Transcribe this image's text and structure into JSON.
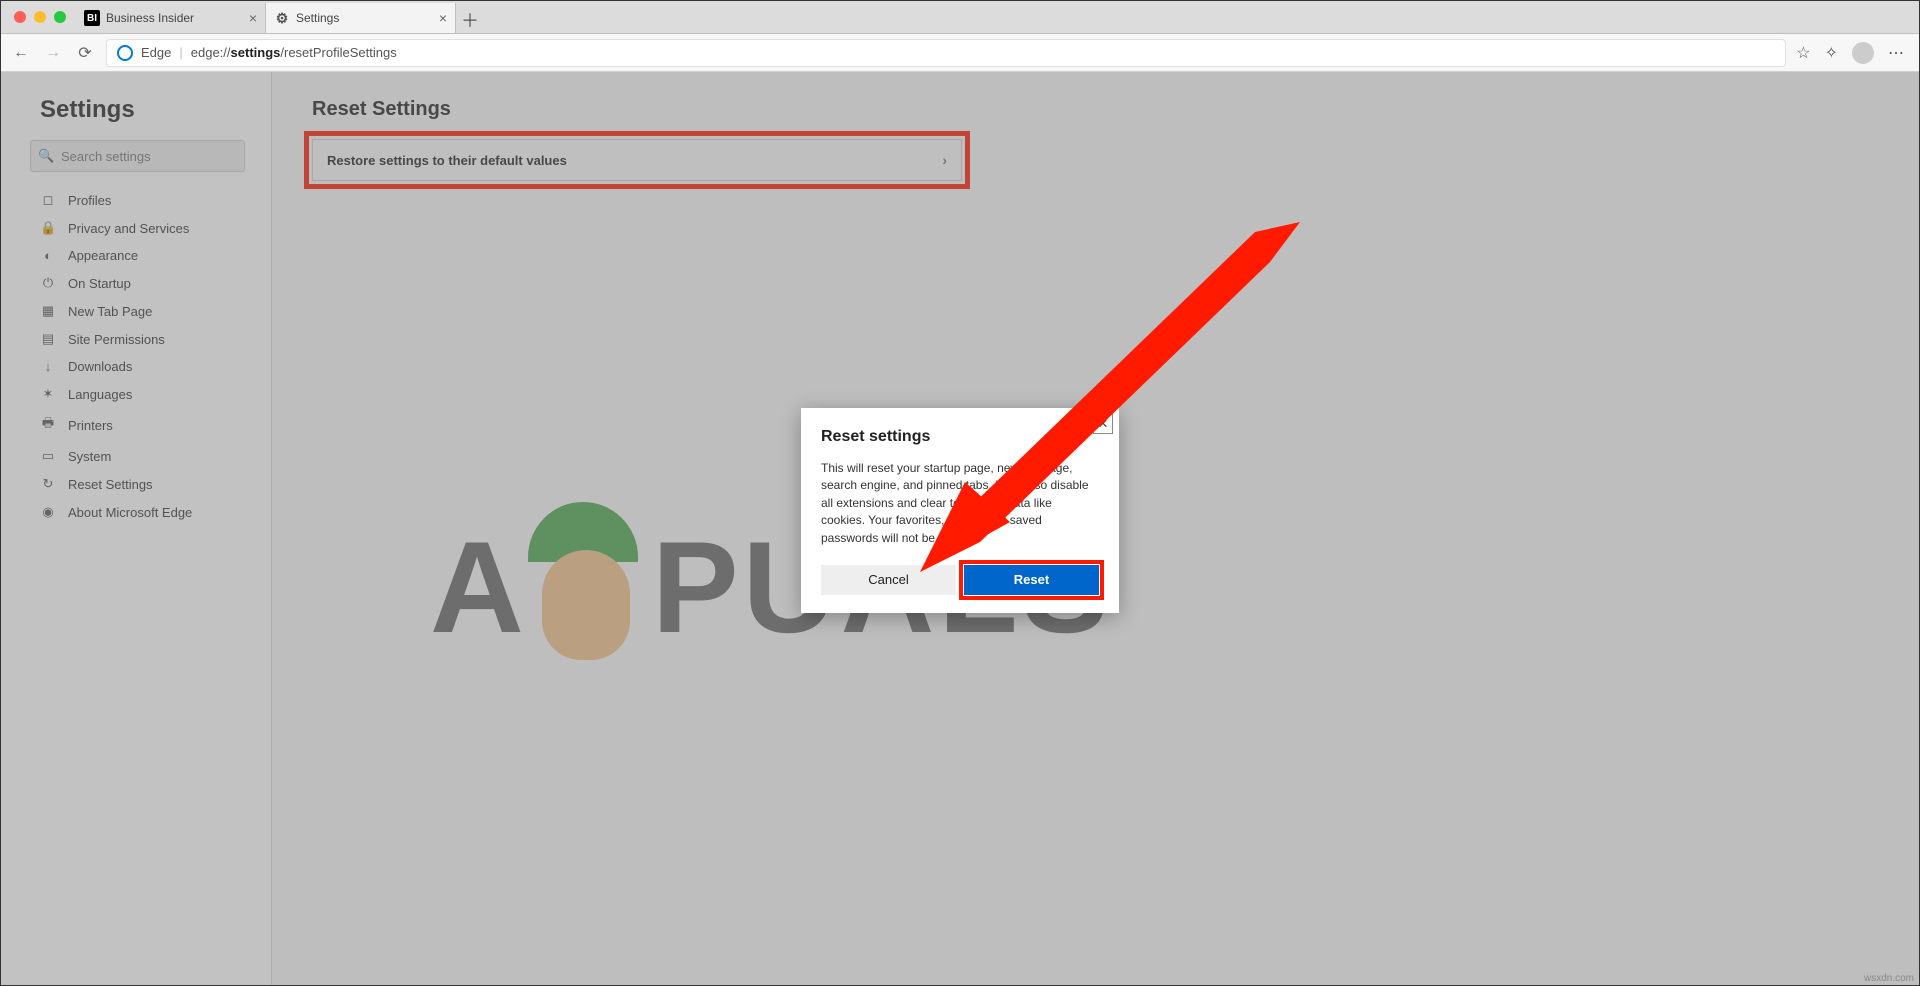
{
  "window": {
    "tabs": [
      {
        "favicon_text": "BI",
        "title": "Business Insider"
      },
      {
        "favicon_text": "⚙",
        "title": "Settings"
      }
    ],
    "newtab_glyph": "＋"
  },
  "toolbar": {
    "back_glyph": "←",
    "forward_glyph": "→",
    "reload_glyph": "⟳",
    "site_label": "Edge",
    "url_prefix": "edge://",
    "url_bold": "settings",
    "url_suffix": "/resetProfileSettings",
    "star_glyph": "☆",
    "collections_glyph": "✧",
    "more_glyph": "⋯"
  },
  "sidebar": {
    "title": "Settings",
    "search_placeholder": "Search settings",
    "items": [
      {
        "icon": "◻",
        "label": "Profiles"
      },
      {
        "icon": "🔒",
        "label": "Privacy and Services"
      },
      {
        "icon": "◐",
        "label": "Appearance"
      },
      {
        "icon": "⏻",
        "label": "On Startup"
      },
      {
        "icon": "▦",
        "label": "New Tab Page"
      },
      {
        "icon": "▤",
        "label": "Site Permissions"
      },
      {
        "icon": "↓",
        "label": "Downloads"
      },
      {
        "icon": "✶",
        "label": "Languages"
      },
      {
        "icon": "🖶",
        "label": "Printers"
      },
      {
        "icon": "▭",
        "label": "System"
      },
      {
        "icon": "↻",
        "label": "Reset Settings"
      },
      {
        "icon": "◉",
        "label": "About Microsoft Edge"
      }
    ]
  },
  "main": {
    "heading": "Reset Settings",
    "row_label": "Restore settings to their default values",
    "row_chevron": "›"
  },
  "dialog": {
    "title": "Reset settings",
    "body": "This will reset your startup page, new tab page, search engine, and pinned tabs. It will also disable all extensions and clear temporary data like cookies. Your favorites, history and saved passwords will not be cleared.",
    "cancel": "Cancel",
    "reset": "Reset",
    "close_glyph": "✕"
  },
  "watermark": {
    "prefix": "A",
    "suffix": "PUALS"
  },
  "credit": "wsxdn.com"
}
